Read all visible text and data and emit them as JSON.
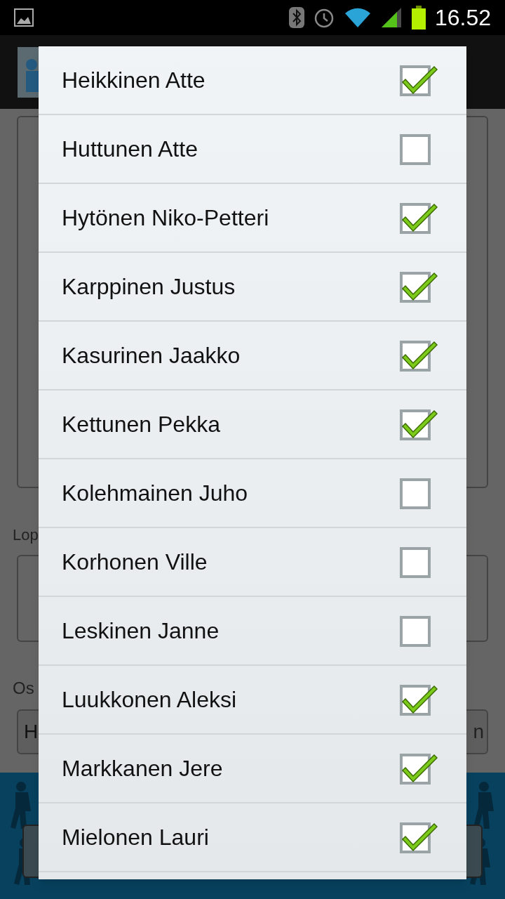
{
  "status_bar": {
    "time": "16.52"
  },
  "background": {
    "end_label": "Lop",
    "participants_label": "Os",
    "dropdown_value": "H",
    "dropdown_end": "n"
  },
  "dialog": {
    "items": [
      {
        "name": "Heikkinen Atte",
        "checked": true
      },
      {
        "name": "Huttunen Atte",
        "checked": false
      },
      {
        "name": "Hytönen Niko-Petteri",
        "checked": true
      },
      {
        "name": "Karppinen Justus",
        "checked": true
      },
      {
        "name": "Kasurinen Jaakko",
        "checked": true
      },
      {
        "name": "Kettunen Pekka",
        "checked": true
      },
      {
        "name": "Kolehmainen Juho",
        "checked": false
      },
      {
        "name": "Korhonen Ville",
        "checked": false
      },
      {
        "name": "Leskinen Janne",
        "checked": false
      },
      {
        "name": "Luukkonen Aleksi",
        "checked": true
      },
      {
        "name": "Markkanen Jere",
        "checked": true
      },
      {
        "name": "Mielonen Lauri",
        "checked": true
      }
    ]
  }
}
